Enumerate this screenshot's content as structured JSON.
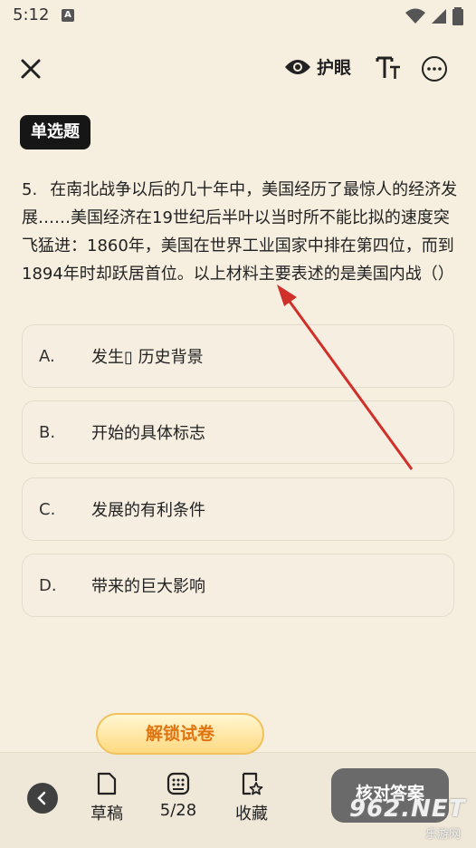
{
  "status": {
    "time": "5:12",
    "a_icon": "A"
  },
  "topbar": {
    "eye_care_label": "护眼"
  },
  "question": {
    "type_badge": "单选题",
    "number": "5.",
    "text": "在南北战争以后的几十年中，美国经历了最惊人的经济发展……美国经济在19世纪后半叶以当时所不能比拟的速度突飞猛进：1860年，美国在世界工业国家中排在第四位，而到1894年时却跃居首位。以上材料主要表述的是美国内战（）"
  },
  "options": [
    {
      "letter": "A.",
      "text": "发生▯ 历史背景"
    },
    {
      "letter": "B.",
      "text": "开始的具体标志"
    },
    {
      "letter": "C.",
      "text": "发展的有利条件"
    },
    {
      "letter": "D.",
      "text": "带来的巨大影响"
    }
  ],
  "bottom": {
    "unlock_label": "解锁试卷",
    "draft_label": "草稿",
    "progress_label": "5/28",
    "favorite_label": "收藏",
    "check_answer_label": "核对答案"
  },
  "watermark": {
    "main": "962.NET",
    "sub": "乐游网"
  },
  "colors": {
    "background": "#f6eedf",
    "unlock_text": "#e07411",
    "arrow": "#d0302a"
  },
  "icons": [
    "close-icon",
    "eye-icon",
    "font-size-icon",
    "more-icon",
    "back-icon",
    "draft-icon",
    "grid-icon",
    "favorite-icon"
  ]
}
